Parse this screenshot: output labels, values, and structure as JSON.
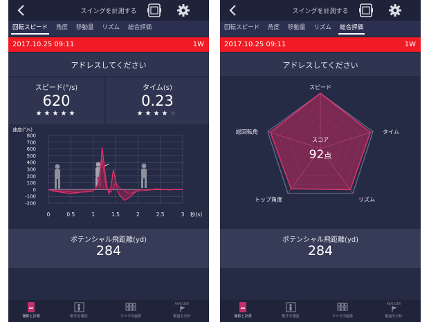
{
  "header": {
    "title": "スイングを計測する"
  },
  "tabs": [
    "回転スピード",
    "角度",
    "移動量",
    "リズム",
    "総合評価"
  ],
  "session": {
    "date": "2017.10.25 09:11",
    "club": "1W"
  },
  "address_prompt": "アドレスしてください",
  "speed": {
    "label": "スピード(°/s)",
    "value": "620",
    "stars": 5,
    "stars_max": 5
  },
  "time": {
    "label": "タイム(s)",
    "value": "0.23",
    "stars": 4,
    "stars_max": 5
  },
  "chart_data": {
    "type": "line",
    "ylabel": "速度(°/s)",
    "xunit": "秒(s)",
    "yticks": [
      800,
      700,
      600,
      500,
      400,
      300,
      200,
      100,
      0,
      -100,
      -200
    ],
    "xticks": [
      "0",
      "0.5",
      "1",
      "1.5",
      "2",
      "2.5",
      "3"
    ],
    "ylim": [
      -200,
      800
    ],
    "xlim": [
      0,
      3
    ],
    "grid": true,
    "colors": {
      "line": "#e0306a",
      "fill": "#7a2752",
      "grid": "#565b7c"
    },
    "series": [
      {
        "x": [
          0,
          0.1,
          0.2,
          0.3,
          0.4,
          0.5,
          0.6,
          0.7,
          0.8,
          0.9,
          1.0,
          1.05,
          1.1,
          1.15,
          1.2,
          1.25,
          1.3,
          1.35,
          1.4,
          1.45,
          1.5,
          1.55,
          1.6,
          1.7,
          1.8,
          1.9,
          2.0,
          2.1,
          2.2,
          2.3,
          2.4,
          2.5,
          2.6,
          2.7,
          2.8,
          2.9,
          3.0
        ],
        "values": [
          0,
          -20,
          -30,
          -40,
          -50,
          -60,
          -50,
          -40,
          -30,
          -20,
          -20,
          10,
          80,
          200,
          620,
          350,
          60,
          -60,
          50,
          290,
          140,
          -30,
          -90,
          -160,
          -120,
          -60,
          -10,
          0,
          -5,
          0,
          10,
          5,
          0,
          -5,
          0,
          0,
          0
        ]
      },
      {
        "x": [
          0,
          0.3,
          0.6,
          0.9,
          1.0,
          1.1,
          1.15,
          1.2,
          1.25,
          1.3,
          1.4,
          1.5,
          1.6,
          1.8,
          2.0,
          2.4,
          3.0
        ],
        "values": [
          0,
          -25,
          -40,
          -35,
          -20,
          60,
          300,
          450,
          200,
          20,
          -40,
          100,
          20,
          -60,
          -20,
          0,
          0
        ]
      }
    ]
  },
  "radar": {
    "axes": [
      "スピード",
      "タイム",
      "リズム",
      "トップ角度",
      "総回転角"
    ],
    "score_label": "スコア",
    "score": "92",
    "score_unit": "点",
    "values": [
      1.0,
      0.95,
      0.92,
      0.9,
      0.95
    ]
  },
  "distance": {
    "label": "ポテンシャル飛距離(yd)",
    "value": "284"
  },
  "nav": [
    "撮影と計測",
    "動きを確認",
    "カメラ内画像",
    "動画を分析"
  ],
  "nav_badge": "ANALYZER"
}
